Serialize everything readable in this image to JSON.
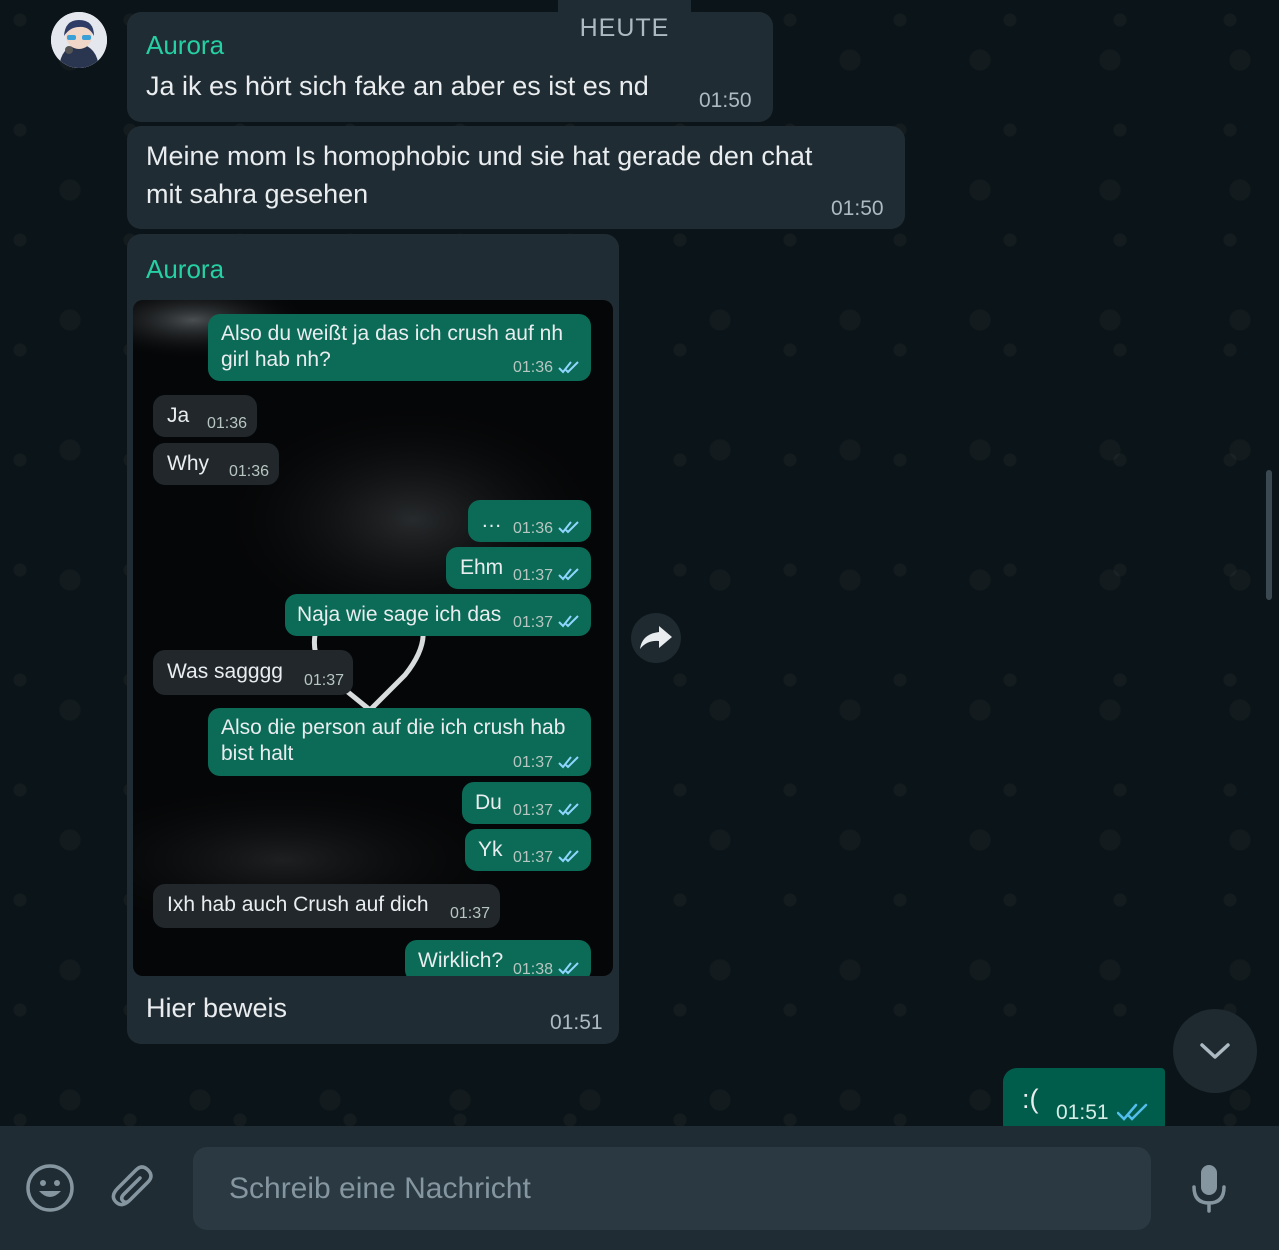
{
  "date_divider": "HEUTE",
  "messages": [
    {
      "sender": "Aurora",
      "text": "Ja ik es hört sich fake an aber es ist es nd",
      "time": "01:50"
    },
    {
      "text_line1": "Meine mom Is homophobic und sie hat gerade den chat",
      "text_line2": "mit sahra gesehen",
      "time": "01:50"
    },
    {
      "sender": "Aurora",
      "caption": "Hier beweis",
      "time": "01:51"
    }
  ],
  "screenshot_messages": [
    {
      "line1": "Also du weißt ja das ich crush auf nh",
      "line2": "girl hab nh?",
      "time": "01:36"
    },
    {
      "text": "Ja",
      "time": "01:36"
    },
    {
      "text": "Why",
      "time": "01:36"
    },
    {
      "text": "…",
      "time": "01:36"
    },
    {
      "text": "Ehm",
      "time": "01:37"
    },
    {
      "text": "Naja wie sage ich das",
      "time": "01:37"
    },
    {
      "text": "Was sagggg",
      "time": "01:37"
    },
    {
      "line1": "Also die person auf die ich crush hab",
      "line2": "bist halt",
      "time": "01:37"
    },
    {
      "text": "Du",
      "time": "01:37"
    },
    {
      "text": "Yk",
      "time": "01:37"
    },
    {
      "text": "Ixh hab auch Crush auf dich",
      "time": "01:37"
    },
    {
      "text": "Wirklich?",
      "time": "01:38"
    }
  ],
  "outgoing": {
    "text": ":(",
    "time": "01:51"
  },
  "composer": {
    "placeholder": "Schreib eine Nachricht"
  },
  "colors": {
    "sender": "#25d0a4",
    "outgoing_bubble": "#005c4b",
    "incoming_bubble": "#202c33",
    "read_ticks": "#53bdeb"
  },
  "icons": [
    "emoji-icon",
    "attach-icon",
    "mic-icon",
    "forward-icon",
    "chevron-down-icon",
    "read-ticks-icon"
  ]
}
